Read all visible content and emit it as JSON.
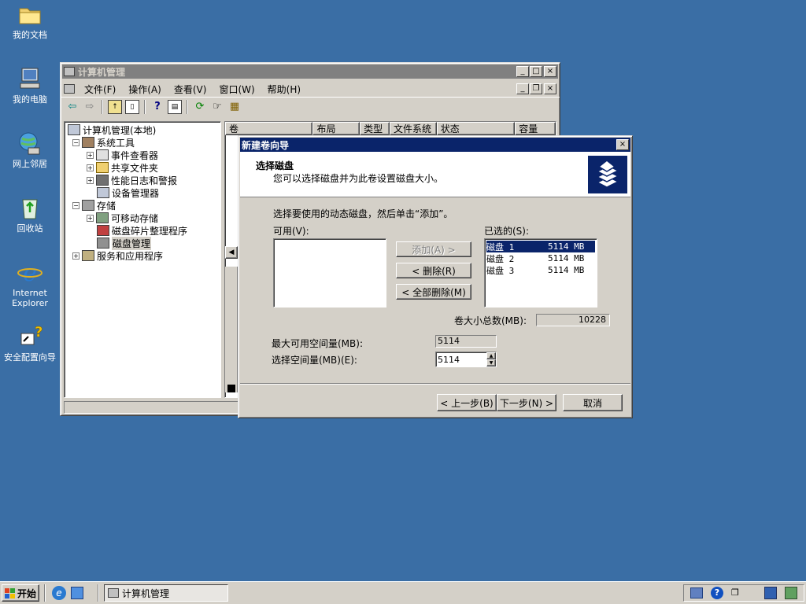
{
  "desktop": {
    "icons": [
      {
        "label": "我的文档"
      },
      {
        "label": "我的电脑"
      },
      {
        "label": "网上邻居"
      },
      {
        "label": "回收站"
      },
      {
        "label": "Internet Explorer"
      },
      {
        "label": "安全配置向导"
      }
    ]
  },
  "mmc": {
    "title": "计算机管理",
    "menu": [
      "文件(F)",
      "操作(A)",
      "查看(V)",
      "窗口(W)",
      "帮助(H)"
    ],
    "tree": [
      {
        "label": "计算机管理(本地)"
      },
      {
        "label": "系统工具"
      },
      {
        "label": "事件查看器"
      },
      {
        "label": "共享文件夹"
      },
      {
        "label": "性能日志和警报"
      },
      {
        "label": "设备管理器"
      },
      {
        "label": "存储"
      },
      {
        "label": "可移动存储"
      },
      {
        "label": "磁盘碎片整理程序"
      },
      {
        "label": "磁盘管理"
      },
      {
        "label": "服务和应用程序"
      }
    ],
    "columns": [
      "卷",
      "布局",
      "类型",
      "文件系统",
      "状态",
      "容量"
    ]
  },
  "wizard": {
    "title": "新建卷向导",
    "header_title": "选择磁盘",
    "header_subtitle": "您可以选择磁盘并为此卷设置磁盘大小。",
    "instruction": "选择要使用的动态磁盘，然后单击“添加”。",
    "available_label": "可用(V):",
    "selected_label": "已选的(S):",
    "add_button": "添加(A) >",
    "remove_button": "< 删除(R)",
    "remove_all_button": "< 全部删除(M)",
    "selected_disks": [
      {
        "name": "磁盘 1",
        "size": "5114 MB"
      },
      {
        "name": "磁盘 2",
        "size": "5114 MB"
      },
      {
        "name": "磁盘 3",
        "size": "5114 MB"
      }
    ],
    "total_label": "卷大小总数(MB):",
    "total_value": "10228",
    "max_label": "最大可用空间量(MB):",
    "max_value": "5114",
    "select_label": "选择空间量(MB)(E):",
    "select_value": "5114",
    "back_button": "< 上一步(B)",
    "next_button": "下一步(N) >",
    "cancel_button": "取消"
  },
  "taskbar": {
    "start_label": "开始",
    "task_label": "计算机管理"
  }
}
